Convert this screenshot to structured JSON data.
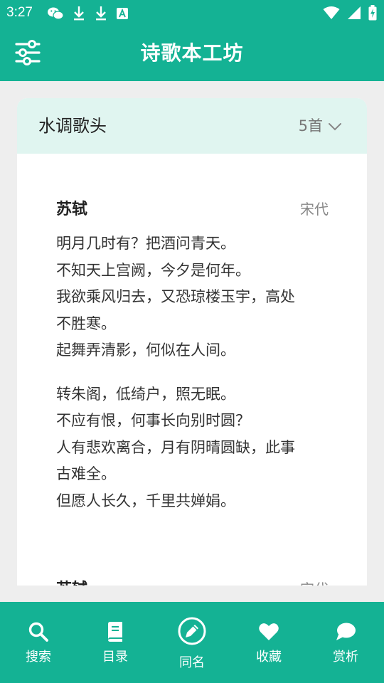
{
  "status_bar": {
    "time": "3:27",
    "left_icons": [
      "wechat-icon",
      "download-icon",
      "download-icon",
      "a-badge-icon"
    ],
    "right_icons": [
      "wifi-icon",
      "signal-icon",
      "battery-charging-icon"
    ]
  },
  "app_bar": {
    "title": "诗歌本工坊",
    "menu_icon": "sliders-icon"
  },
  "card": {
    "title": "水调歌头",
    "count": "5首",
    "toggle_icon": "chevron-down-icon"
  },
  "poems": [
    {
      "author": "苏轼",
      "dynasty": "宋代",
      "lines": [
        "明月几时有？把酒问青天。",
        "不知天上宫阙，今夕是何年。",
        "我欲乘风归去，又恐琼楼玉宇，高处",
        "不胜寒。",
        "起舞弄清影，何似在人间。",
        "转朱阁，低绮户，照无眠。",
        "不应有恨，何事长向别时圆？",
        "人有悲欢离合，月有阴晴圆缺，此事",
        "古难全。",
        "但愿人长久，千里共婵娟。"
      ]
    },
    {
      "author": "苏轼",
      "dynasty": "宋代"
    }
  ],
  "tabs": [
    {
      "label": "搜索",
      "icon": "search-icon"
    },
    {
      "label": "目录",
      "icon": "book-icon"
    },
    {
      "label": "同名",
      "icon": "pencil-icon"
    },
    {
      "label": "收藏",
      "icon": "heart-icon"
    },
    {
      "label": "赏析",
      "icon": "chat-bubble-icon"
    }
  ],
  "colors": {
    "primary": "#14b294",
    "card_header": "#e0f5f0",
    "background": "#eeeeee"
  }
}
